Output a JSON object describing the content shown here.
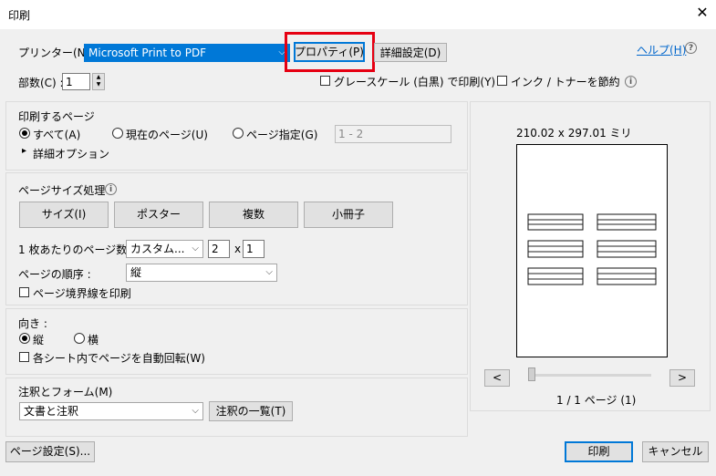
{
  "window": {
    "title": "印刷",
    "close_glyph": "✕"
  },
  "printer": {
    "label": "プリンター(N) :",
    "selected": "Microsoft Print to PDF",
    "properties_button": "プロパティ(P)",
    "advanced_button": "詳細設定(D)",
    "help_link": "ヘルプ(H)",
    "help_glyph": "?"
  },
  "copies": {
    "label": "部数(C) :",
    "value": "1"
  },
  "options": {
    "grayscale": "グレースケール (白黒) で印刷(Y)",
    "save_ink": "インク / トナーを節約"
  },
  "pages": {
    "title": "印刷するページ",
    "all": "すべて(A)",
    "current": "現在のページ(U)",
    "range": "ページ指定(G)",
    "range_value": "1 - 2",
    "more_options": "詳細オプション"
  },
  "page_sizing": {
    "title": "ページサイズ処理",
    "size_btn": "サイズ(I)",
    "poster_btn": "ポスター",
    "multiple_btn": "複数",
    "booklet_btn": "小冊子",
    "pages_per_sheet_label": "1 枚あたりのページ数 :",
    "pages_per_sheet_select": "カスタム...",
    "cols": "2",
    "x": "x",
    "rows": "1",
    "order_label": "ページの順序 :",
    "order_value": "縦",
    "border_label": "ページ境界線を印刷"
  },
  "orientation": {
    "title": "向き :",
    "portrait": "縦",
    "landscape": "横",
    "auto_rotate": "各シート内でページを自動回転(W)"
  },
  "comments": {
    "title": "注釈とフォーム(M)",
    "select": "文書と注釈",
    "summary_btn": "注釈の一覧(T)"
  },
  "preview": {
    "size": "210.02 x 297.01 ミリ",
    "prev": "<",
    "next": ">",
    "page_info": "1 / 1 ページ (1)"
  },
  "footer": {
    "page_setup": "ページ設定(S)...",
    "print": "印刷",
    "cancel": "キャンセル"
  },
  "icons": {
    "info": "i",
    "dropdown": "⌵",
    "triangle": "▸",
    "spin_up": "▲",
    "spin_down": "▼"
  }
}
